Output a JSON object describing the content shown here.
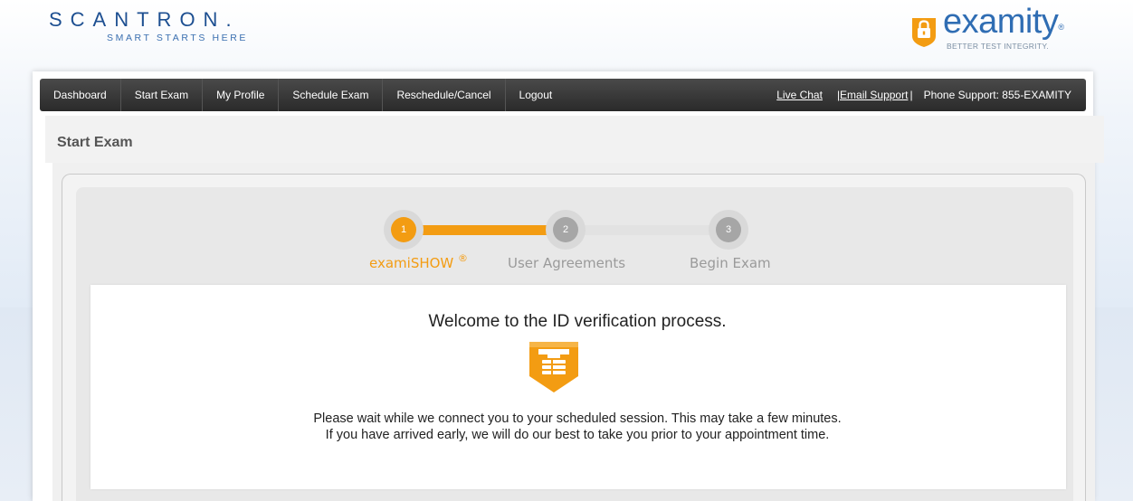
{
  "header": {
    "brand_left": "SCANTRON.",
    "brand_left_tagline": "SMART STARTS HERE",
    "brand_right": "examity",
    "brand_right_reg": "®",
    "brand_right_tagline": "BETTER TEST INTEGRITY."
  },
  "nav": {
    "items": [
      {
        "label": "Dashboard"
      },
      {
        "label": "Start Exam"
      },
      {
        "label": "My Profile"
      },
      {
        "label": "Schedule Exam"
      },
      {
        "label": "Reschedule/Cancel"
      },
      {
        "label": "Logout"
      }
    ],
    "live_chat": "Live Chat",
    "email_support": "|Email Support",
    "separator": "|",
    "phone_support": "Phone Support: 855-EXAMITY"
  },
  "page": {
    "title": "Start Exam"
  },
  "steps": [
    {
      "number": "1",
      "label": "examiSHOW",
      "mark": "®",
      "state": "active"
    },
    {
      "number": "2",
      "label": "User Agreements",
      "state": "pending"
    },
    {
      "number": "3",
      "label": "Begin Exam",
      "state": "pending"
    }
  ],
  "content": {
    "heading": "Welcome to the ID verification process.",
    "line1": "Please wait while we connect you to your scheduled session. This may take a few minutes.",
    "line2": "If you have arrived early, we will do our best to take you prior to your appointment time."
  },
  "colors": {
    "accent": "#f39c12",
    "brand_blue": "#2f6db3",
    "nav_bg": "#333333",
    "step_pending": "#a6a6a6"
  },
  "icons": {
    "logo_lock": "lock-icon",
    "content_icon": "shield-id-icon"
  }
}
